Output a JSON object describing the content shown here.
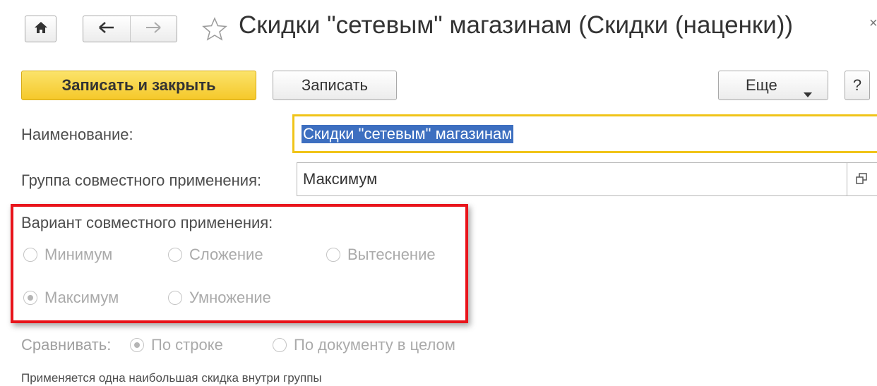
{
  "window": {
    "title": "Скидки \"сетевым\" магазинам (Скидки (наценки))",
    "close_glyph": "×"
  },
  "nav": {
    "home_icon": "home-icon",
    "back_icon": "arrow-left-icon",
    "forward_icon": "arrow-right-icon",
    "favorite_icon": "star-outline-icon"
  },
  "toolbar": {
    "save_close_label": "Записать и закрыть",
    "save_label": "Записать",
    "more_label": "Еще",
    "help_label": "?"
  },
  "form": {
    "name_label": "Наименование:",
    "name_value": "Скидки \"сетевым\" магазинам",
    "group_label": "Группа совместного применения:",
    "group_value": "Максимум",
    "variant_label": "Вариант совместного применения:",
    "variant_options": [
      {
        "label": "Минимум",
        "checked": false
      },
      {
        "label": "Сложение",
        "checked": false
      },
      {
        "label": "Вытеснение",
        "checked": false
      },
      {
        "label": "Максимум",
        "checked": true
      },
      {
        "label": "Умножение",
        "checked": false
      }
    ],
    "compare_label": "Сравнивать:",
    "compare_options": [
      {
        "label": "По строке",
        "checked": true
      },
      {
        "label": "По документу в целом",
        "checked": false
      }
    ],
    "hint": "Применяется одна наибольшая скидка внутри группы"
  },
  "colors": {
    "primary_button": "#f5c82a",
    "highlight_border": "#e8141b",
    "focus_border": "#f0c419",
    "selection": "#3d6fc0"
  }
}
